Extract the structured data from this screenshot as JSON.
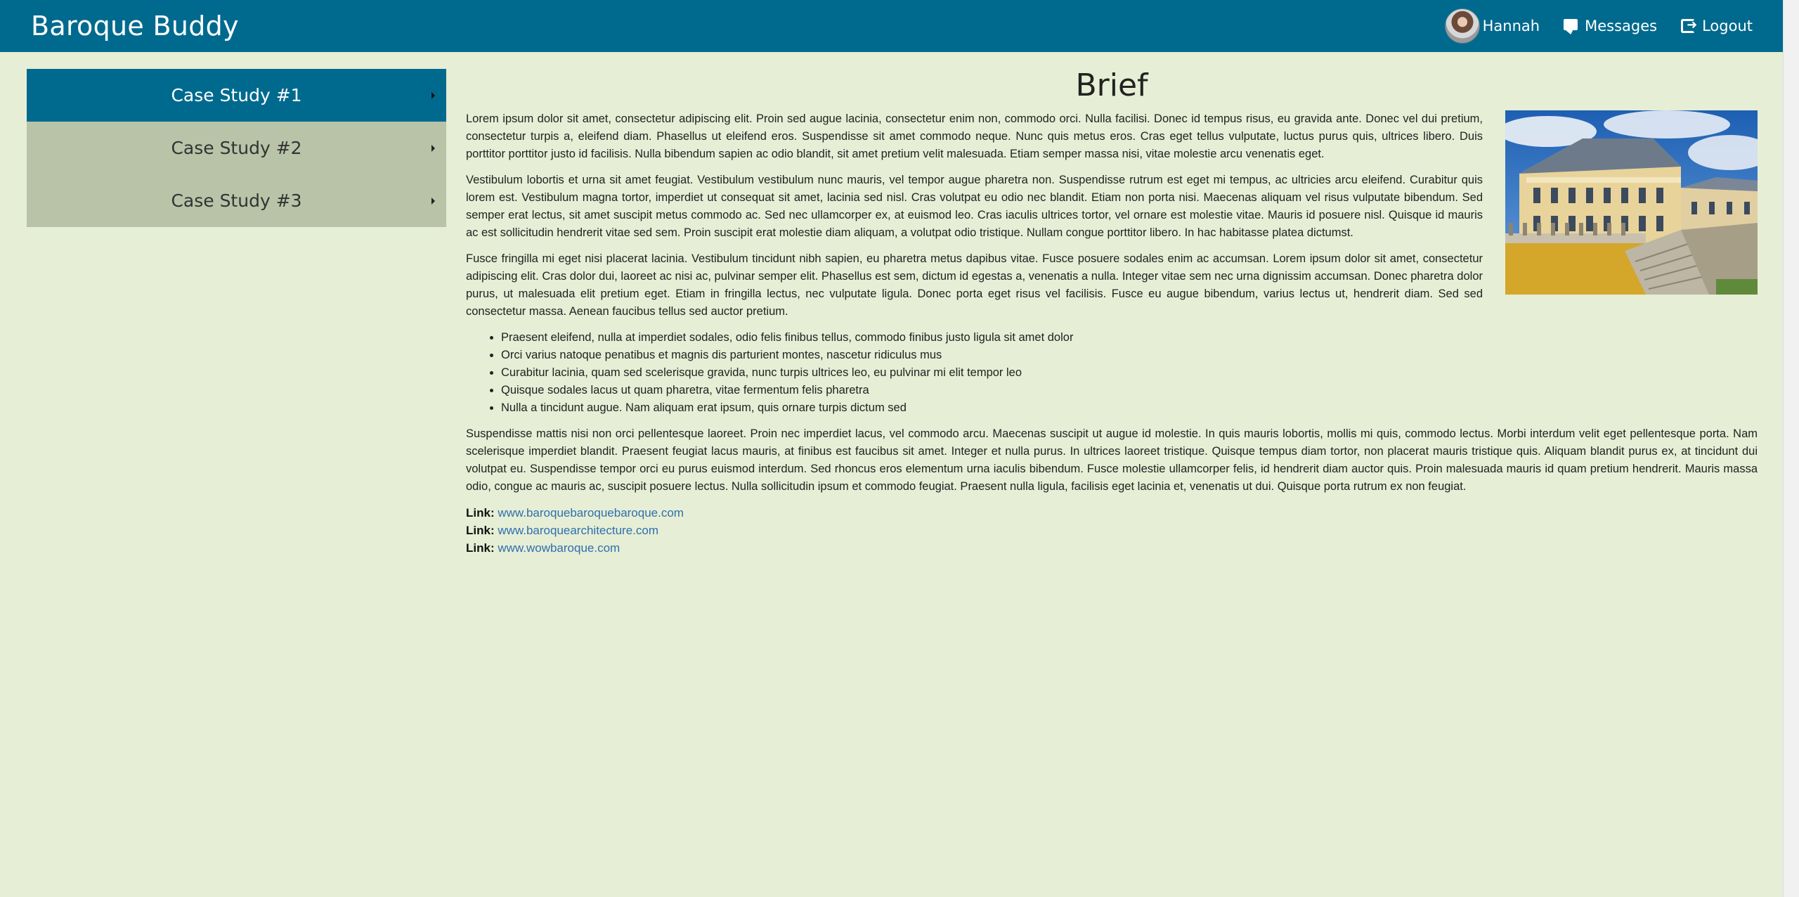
{
  "app": {
    "brand": "Baroque Buddy"
  },
  "nav": {
    "user_name": "Hannah",
    "messages_label": "Messages",
    "logout_label": "Logout"
  },
  "sidebar": {
    "items": [
      {
        "label": "Case Study #1",
        "active": true
      },
      {
        "label": "Case Study #2",
        "active": false
      },
      {
        "label": "Case Study #3",
        "active": false
      }
    ]
  },
  "main": {
    "title": "Brief",
    "paragraphs": [
      "Lorem ipsum dolor sit amet, consectetur adipiscing elit. Proin sed augue lacinia, consectetur enim non, commodo orci. Nulla facilisi. Donec id tempus risus, eu gravida ante. Donec vel dui pretium, consectetur turpis a, eleifend diam. Phasellus ut eleifend eros. Suspendisse sit amet commodo neque. Nunc quis metus eros. Cras eget tellus vulputate, luctus purus quis, ultrices libero. Duis porttitor porttitor justo id facilisis. Nulla bibendum sapien ac odio blandit, sit amet pretium velit malesuada. Etiam semper massa nisi, vitae molestie arcu venenatis eget.",
      "Vestibulum lobortis et urna sit amet feugiat. Vestibulum vestibulum nunc mauris, vel tempor augue pharetra non. Suspendisse rutrum est eget mi tempus, ac ultricies arcu eleifend. Curabitur quis lorem est. Vestibulum magna tortor, imperdiet ut consequat sit amet, lacinia sed nisl. Cras volutpat eu odio nec blandit. Etiam non porta nisi. Maecenas aliquam vel risus vulputate bibendum. Sed semper erat lectus, sit amet suscipit metus commodo ac. Sed nec ullamcorper ex, at euismod leo. Cras iaculis ultrices tortor, vel ornare est molestie vitae. Mauris id posuere nisl. Quisque id mauris ac est sollicitudin hendrerit vitae sed sem. Proin suscipit erat molestie diam aliquam, a volutpat odio tristique. Nullam congue porttitor libero. In hac habitasse platea dictumst.",
      "Fusce fringilla mi eget nisi placerat lacinia. Vestibulum tincidunt nibh sapien, eu pharetra metus dapibus vitae. Fusce posuere sodales enim ac accumsan. Lorem ipsum dolor sit amet, consectetur adipiscing elit. Cras dolor dui, laoreet ac nisi ac, pulvinar semper elit. Phasellus est sem, dictum id egestas a, venenatis a nulla. Integer vitae sem nec urna dignissim accumsan. Donec pharetra dolor purus, ut malesuada elit pretium eget. Etiam in fringilla lectus, nec vulputate ligula. Donec porta eget risus vel facilisis. Fusce eu augue bibendum, varius lectus ut, hendrerit diam. Sed sed consectetur massa. Aenean faucibus tellus sed auctor pretium."
    ],
    "bullets": [
      "Praesent eleifend, nulla at imperdiet sodales, odio felis finibus tellus, commodo finibus justo ligula sit amet dolor",
      "Orci varius natoque penatibus et magnis dis parturient montes, nascetur ridiculus mus",
      "Curabitur lacinia, quam sed scelerisque gravida, nunc turpis ultrices leo, eu pulvinar mi elit tempor leo",
      "Quisque sodales lacus ut quam pharetra, vitae fermentum felis pharetra",
      "Nulla a tincidunt augue. Nam aliquam erat ipsum, quis ornare turpis dictum sed"
    ],
    "closing_paragraph": "Suspendisse mattis nisi non orci pellentesque laoreet. Proin nec imperdiet lacus, vel commodo arcu. Maecenas suscipit ut augue id molestie. In quis mauris lobortis, mollis mi quis, commodo lectus. Morbi interdum velit eget pellentesque porta. Nam scelerisque imperdiet blandit. Praesent feugiat lacus mauris, at finibus est faucibus sit amet. Integer et nulla purus. In ultrices laoreet tristique. Quisque tempus diam tortor, non placerat mauris tristique quis. Aliquam blandit purus ex, at tincidunt dui volutpat eu. Suspendisse tempor orci eu purus euismod interdum. Sed rhoncus eros elementum urna iaculis bibendum. Fusce molestie ullamcorper felis, id hendrerit diam auctor quis. Proin malesuada mauris id quam pretium hendrerit. Mauris massa odio, congue ac mauris ac, suscipit posuere lectus. Nulla sollicitudin ipsum et commodo feugiat. Praesent nulla ligula, facilisis eget lacinia et, venenatis ut dui. Quisque porta rutrum ex non feugiat.",
    "links": [
      {
        "label": "Link:",
        "text": "www.baroquebaroquebaroque.com"
      },
      {
        "label": "Link:",
        "text": "www.baroquearchitecture.com"
      },
      {
        "label": "Link:",
        "text": "www.wowbaroque.com"
      }
    ]
  },
  "colors": {
    "navbar": "#006a8e",
    "background": "#e6eed5",
    "sidebar_inactive": "#b8c3a8",
    "link": "#2f6fae"
  },
  "icons": [
    "avatar",
    "messages-icon",
    "logout-icon",
    "caret-right-icon"
  ]
}
